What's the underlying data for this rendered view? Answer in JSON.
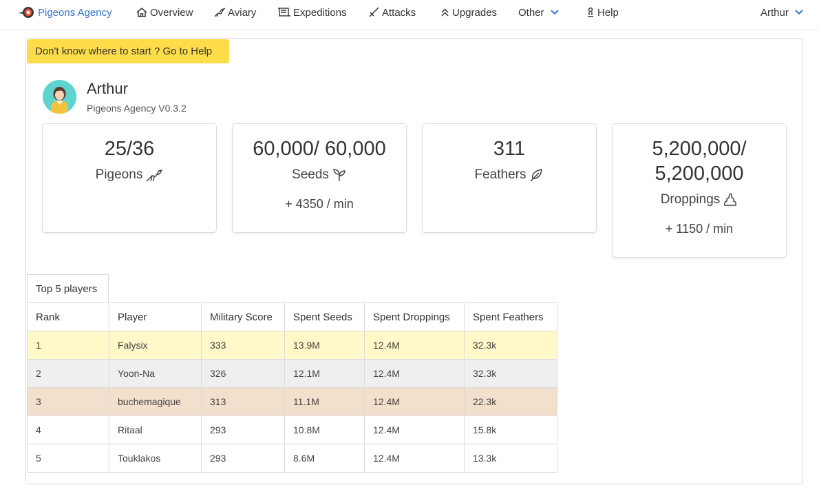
{
  "nav": {
    "brand": "Pigeons Agency",
    "overview": "Overview",
    "aviary": "Aviary",
    "expeditions": "Expeditions",
    "attacks": "Attacks",
    "upgrades": "Upgrades",
    "other": "Other",
    "help": "Help",
    "user": "Arthur"
  },
  "help_banner": "Don't know where to start ? Go to Help",
  "profile": {
    "name": "Arthur",
    "version": "Pigeons Agency V0.3.2"
  },
  "cards": {
    "pigeons": {
      "value": "25/36",
      "label": "Pigeons"
    },
    "seeds": {
      "value": "60,000/ 60,000",
      "label": "Seeds",
      "rate": "+ 4350 / min"
    },
    "feathers": {
      "value": "311",
      "label": "Feathers"
    },
    "droppings": {
      "value_line1": "5,200,000/",
      "value_line2": "5,200,000",
      "label": "Droppings",
      "rate": "+ 1150 / min"
    }
  },
  "leaderboard": {
    "tab": "Top 5 players",
    "headers": [
      "Rank",
      "Player",
      "Military Score",
      "Spent Seeds",
      "Spent Droppings",
      "Spent Feathers"
    ],
    "rows": [
      [
        "1",
        "Falysix",
        "333",
        "13.9M",
        "12.4M",
        "32.3k"
      ],
      [
        "2",
        "Yoon-Na",
        "326",
        "12.1M",
        "12.4M",
        "32.3k"
      ],
      [
        "3",
        "buchemagique",
        "313",
        "11.1M",
        "12.4M",
        "22.3k"
      ],
      [
        "4",
        "Ritaal",
        "293",
        "10.8M",
        "12.4M",
        "15.8k"
      ],
      [
        "5",
        "Touklakos",
        "293",
        "8.6M",
        "12.4M",
        "13.3k"
      ]
    ]
  },
  "colors": {
    "brand": "#3b73c7",
    "banner": "#ffdc4a",
    "rank1": "#fff8c9",
    "rank2": "#efefef",
    "rank3": "#f2dfcc"
  },
  "icons": [
    "pigeon-logo-icon",
    "home-icon",
    "bird-icon",
    "scroll-icon",
    "sword-icon",
    "chevron-double-up-icon",
    "chevron-down-icon",
    "chess-pawn-icon",
    "pigeon-icon",
    "sprout-icon",
    "feather-icon",
    "dropping-icon"
  ]
}
